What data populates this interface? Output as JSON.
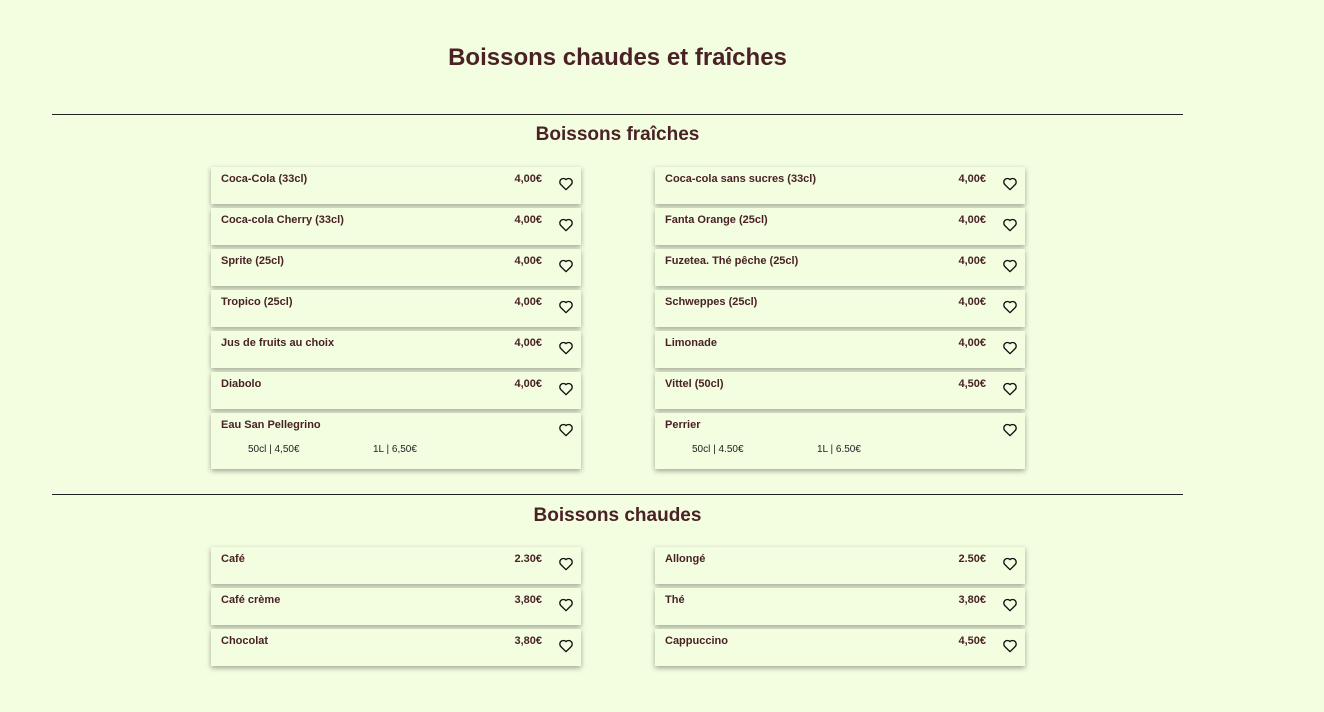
{
  "page": {
    "title": "Boissons chaudes et fraîches"
  },
  "colors": {
    "background": "#f3fde0",
    "text": "#4a2226",
    "divider": "#222222"
  },
  "sections": [
    {
      "title": "Boissons fraîches",
      "left": [
        {
          "name": "Coca-Cola (33cl)",
          "price": "4,00€"
        },
        {
          "name": "Coca-cola Cherry (33cl)",
          "price": "4,00€"
        },
        {
          "name": "Sprite (25cl)",
          "price": "4,00€"
        },
        {
          "name": "Tropico (25cl)",
          "price": "4,00€"
        },
        {
          "name": "Jus de fruits au choix",
          "price": "4,00€"
        },
        {
          "name": "Diabolo",
          "price": "4,00€"
        },
        {
          "name": "Eau San Pellegrino",
          "variants": [
            "50cl | 4,50€",
            "1L | 6,50€"
          ]
        }
      ],
      "right": [
        {
          "name": "Coca-cola sans sucres (33cl)",
          "price": "4,00€"
        },
        {
          "name": "Fanta Orange (25cl)",
          "price": "4,00€"
        },
        {
          "name": "Fuzetea. Thé pêche (25cl)",
          "price": "4,00€"
        },
        {
          "name": "Schweppes (25cl)",
          "price": "4,00€"
        },
        {
          "name": "Limonade",
          "price": "4,00€"
        },
        {
          "name": "Vittel (50cl)",
          "price": "4,50€"
        },
        {
          "name": "Perrier",
          "variants": [
            "50cl | 4.50€",
            "1L | 6.50€"
          ]
        }
      ]
    },
    {
      "title": "Boissons chaudes",
      "left": [
        {
          "name": "Café",
          "price": "2.30€"
        },
        {
          "name": "Café crème",
          "price": "3,80€"
        },
        {
          "name": "Chocolat",
          "price": "3,80€"
        }
      ],
      "right": [
        {
          "name": "Allongé",
          "price": "2.50€"
        },
        {
          "name": "Thé",
          "price": "3,80€"
        },
        {
          "name": "Cappuccino",
          "price": "4,50€"
        }
      ]
    }
  ],
  "icons": {
    "favorite": "heart-outline-icon"
  }
}
